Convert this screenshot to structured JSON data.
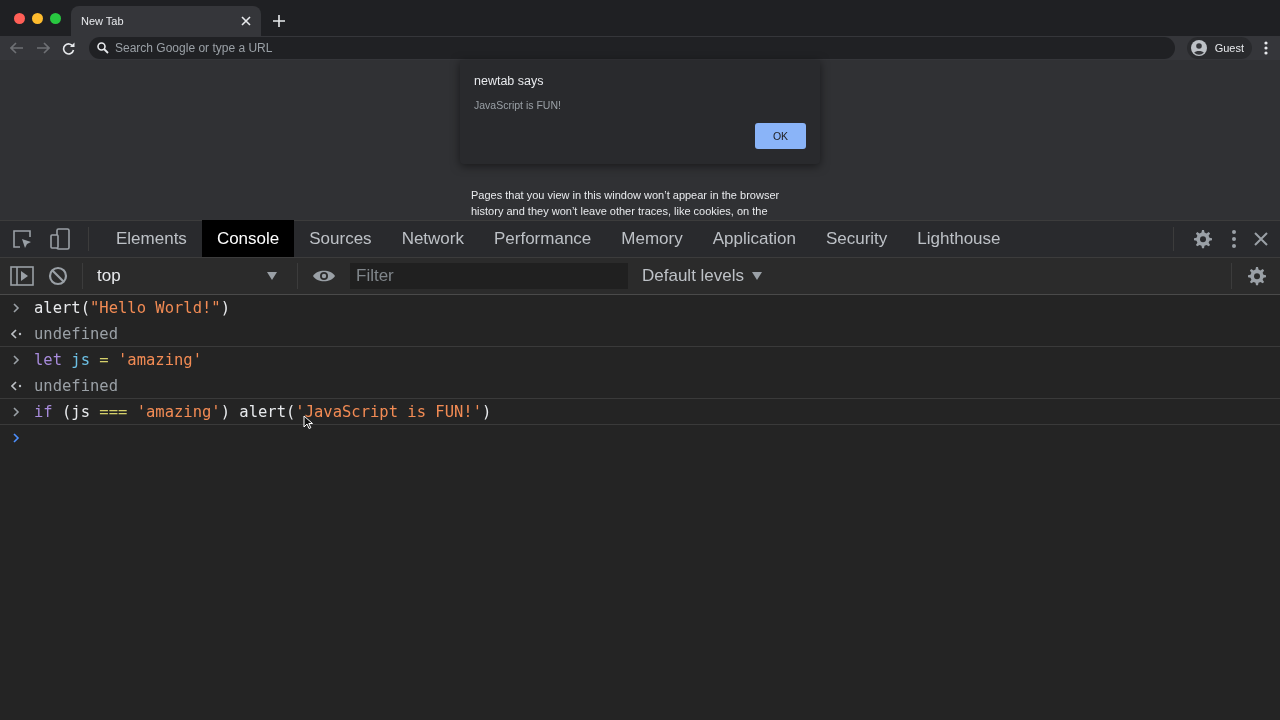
{
  "browser": {
    "tab": {
      "title": "New Tab",
      "selected": true
    },
    "address_bar": {
      "placeholder": "Search Google or type a URL"
    },
    "profile": {
      "label": "Guest"
    }
  },
  "page": {
    "paragraph_lines": [
      "Pages that you view in this window won’t appear in the browser",
      "history and they won’t leave other traces, like cookies, on the"
    ]
  },
  "dialog": {
    "title": "newtab says",
    "message": "JavaScript is FUN!",
    "button": "OK"
  },
  "devtools": {
    "tabs": [
      {
        "label": "Elements",
        "selected": false
      },
      {
        "label": "Console",
        "selected": true
      },
      {
        "label": "Sources",
        "selected": false
      },
      {
        "label": "Network",
        "selected": false
      },
      {
        "label": "Performance",
        "selected": false
      },
      {
        "label": "Memory",
        "selected": false
      },
      {
        "label": "Application",
        "selected": false
      },
      {
        "label": "Security",
        "selected": false
      },
      {
        "label": "Lighthouse",
        "selected": false
      }
    ],
    "context": "top",
    "filter": {
      "placeholder": "Filter"
    },
    "levels": "Default levels"
  },
  "console": [
    {
      "kind": "input",
      "tokens": [
        {
          "kind": "plain",
          "text": "alert("
        },
        {
          "kind": "string",
          "text": "\"Hello World!\""
        },
        {
          "kind": "plain",
          "text": ")"
        }
      ]
    },
    {
      "kind": "output",
      "tokens": [
        {
          "kind": "result",
          "text": "undefined"
        }
      ]
    },
    {
      "kind": "input",
      "tokens": [
        {
          "kind": "keyword",
          "text": "let"
        },
        {
          "kind": "variable",
          "text": " js"
        },
        {
          "kind": "operator",
          "text": " ="
        },
        {
          "kind": "string",
          "text": " 'amazing'"
        }
      ]
    },
    {
      "kind": "output",
      "tokens": [
        {
          "kind": "result",
          "text": "undefined"
        }
      ]
    },
    {
      "kind": "input",
      "tokens": [
        {
          "kind": "keyword",
          "text": "if"
        },
        {
          "kind": "plain",
          "text": " (js "
        },
        {
          "kind": "operator",
          "text": "==="
        },
        {
          "kind": "string",
          "text": " 'amazing'"
        },
        {
          "kind": "plain",
          "text": ") alert("
        },
        {
          "kind": "string",
          "text": "'JavaScript is FUN!'"
        },
        {
          "kind": "plain",
          "text": ")"
        }
      ]
    },
    {
      "kind": "prompt"
    }
  ]
}
